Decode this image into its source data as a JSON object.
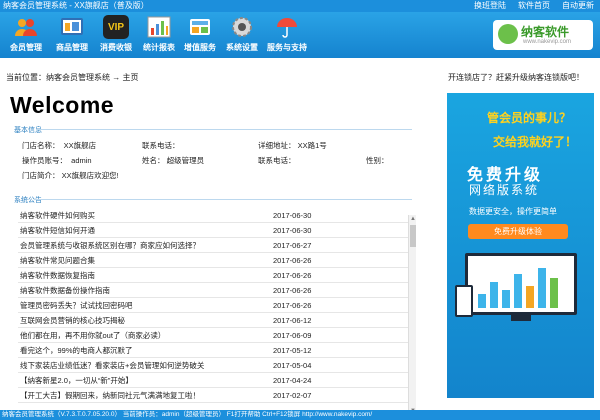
{
  "window": {
    "title": "纳客会员管理系统 - XX旗舰店（普及版）",
    "links": [
      "换班登陆",
      "软件首页",
      "自动更新"
    ]
  },
  "toolbar": {
    "items": [
      {
        "label": "会员管理",
        "icon": "members-icon",
        "color": "#f5a623"
      },
      {
        "label": "商品管理",
        "icon": "goods-icon",
        "color": "#4a90d9"
      },
      {
        "label": "消费收银",
        "icon": "vip-cashier-icon",
        "color": "#333333"
      },
      {
        "label": "统计报表",
        "icon": "report-chart-icon",
        "color": "#e8e8e8"
      },
      {
        "label": "增值服务",
        "icon": "value-added-icon",
        "color": "#5db0e8"
      },
      {
        "label": "系统设置",
        "icon": "settings-gear-icon",
        "color": "#d9d9d9"
      },
      {
        "label": "服务与支持",
        "icon": "umbrella-icon",
        "color": "#f04a3a"
      }
    ]
  },
  "logo": {
    "name": "纳客软件",
    "url": "www.nakevip.com"
  },
  "breadcrumb": "当前位置：纳客会员管理系统 → 主页",
  "upsell_text": "开连锁店了？赶紧升级纳客连锁版吧！",
  "welcome": "Welcome",
  "basic_info": {
    "title": "基本信息",
    "fields": [
      {
        "label": "门店名称：",
        "value": "XX旗舰店"
      },
      {
        "label": "联系电话：",
        "value": ""
      },
      {
        "label": "详细地址：",
        "value": "XX路1号"
      },
      {
        "label": "操作员账号：",
        "value": "admin"
      },
      {
        "label": "姓名：",
        "value": "超级管理员"
      },
      {
        "label": "联系电话：",
        "value": ""
      },
      {
        "label": "性别：",
        "value": ""
      },
      {
        "label": "门店简介：",
        "value": "XX旗舰店欢迎您!"
      }
    ]
  },
  "announcements": {
    "title": "系统公告",
    "rows": [
      {
        "title": "纳客软件硬件如何购买",
        "date": "2017-06-30"
      },
      {
        "title": "纳客软件短信如何开通",
        "date": "2017-06-30"
      },
      {
        "title": "会员管理系统与收银系统区别在哪？商家应如何选择？",
        "date": "2017-06-27"
      },
      {
        "title": "纳客软件常见问题合集",
        "date": "2017-06-26"
      },
      {
        "title": "纳客软件数据恢复指南",
        "date": "2017-06-26"
      },
      {
        "title": "纳客软件数据备份操作指南",
        "date": "2017-06-26"
      },
      {
        "title": "管理员密码丢失？试试找回密码吧",
        "date": "2017-06-26"
      },
      {
        "title": "互联网会员营销的核心技巧揭秘",
        "date": "2017-06-12"
      },
      {
        "title": "他们都在用，再不用你就out了（商家必读）",
        "date": "2017-06-09"
      },
      {
        "title": "看完这个，99%的电商人都沉默了",
        "date": "2017-05-12"
      },
      {
        "title": "线下家装店业绩低迷？看家装店+会员管理如何逆势破关",
        "date": "2017-05-04"
      },
      {
        "title": "【纳客新星2.0，一切从“新”开始】",
        "date": "2017-04-24"
      },
      {
        "title": "【开工大吉】假期回来，纳新同社元气满满地复工啦！",
        "date": "2017-02-07"
      }
    ]
  },
  "ad": {
    "question": "管会员的事儿？",
    "answer": "交给我就好了！",
    "headline": "免费升级",
    "subline": "网络版系统",
    "tagline": "数据更安全，操作更简单",
    "button": "免费升级体验"
  },
  "status_bar": "纳客会员管理系统（V.7.3.T.0.7.05.20.0）  当前操作员：admin（超级管理员）  F1打开帮助 Ctrl+F12锁屏  http://www.nakevip.com/"
}
